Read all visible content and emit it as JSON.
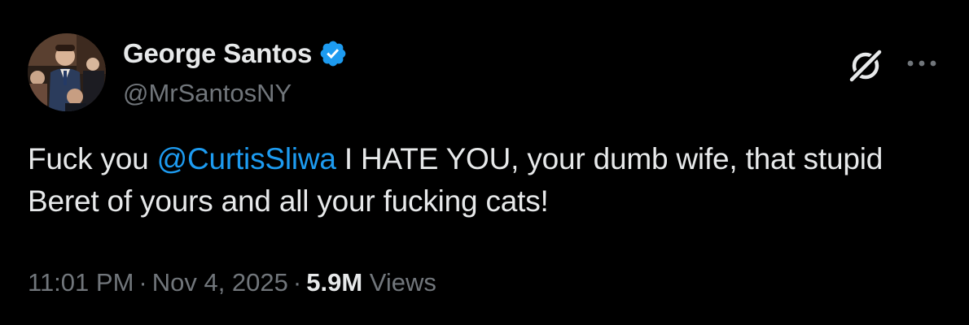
{
  "author": {
    "display_name": "George Santos",
    "handle": "@MrSantosNY",
    "verified": true
  },
  "tweet": {
    "text_before": "Fuck you ",
    "mention": "@CurtisSliwa",
    "text_after": " I HATE YOU, your dumb wife, that stupid Beret of yours and all your fucking cats!"
  },
  "meta": {
    "time": "11:01 PM",
    "separator": "·",
    "date": "Nov 4, 2025",
    "views_count": "5.9M",
    "views_label": "Views"
  },
  "icons": {
    "verified": "verified-badge-icon",
    "grok": "grok-icon",
    "more": "more-options-icon"
  },
  "colors": {
    "background": "#000000",
    "text_primary": "#e7e9ea",
    "text_secondary": "#71767b",
    "accent": "#1d9bf0"
  }
}
